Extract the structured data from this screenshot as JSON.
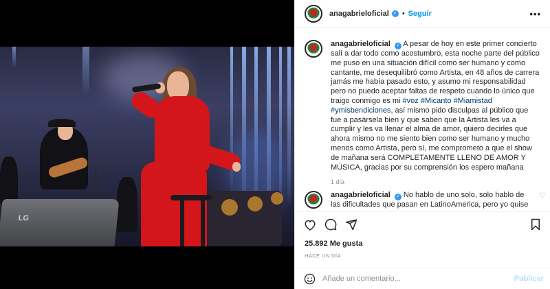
{
  "post": {
    "username": "anagabrieloficial",
    "follow_label": "Seguir",
    "more_icon": "more-horizontal-icon"
  },
  "caption": {
    "username": "anagabrieloficial",
    "text_1": "A pesar de hoy en este primer concierto salí a dar todo como acostumbro, esta noche parte del público me puso en una situación difícil como ser humano y como cantante, me desequilibró como Artista, en 48 años de carrera jamás me había pasado esto, y asumo mi responsabilidad pero no puedo aceptar faltas de respeto cuando lo único que traigo conmigo es mi",
    "hashtags": [
      "#voz",
      "#Micanto",
      "#Miamistad",
      "#ymisbendiciones"
    ],
    "text_2": ", así mismo pido disculpas al público que fue a pasársela bien y que saben que la Artista les va a cumplir y les va llenar el alma de amor, quiero decirles que ahora mismo no me siento bien como ser humano y mucho menos como Artista, pero sí, me comprometo a que el show de mañana será COMPLETAMENTE LLENO DE AMOR Y MÚSICA, gracias por su comprensión los espero mañana",
    "time": "1 día"
  },
  "reply": {
    "username": "anagabrieloficial",
    "text": "No hablo de uno solo, solo hablo de las dificultades que pasan en LatinoAmerica, pero yo quise"
  },
  "stats": {
    "likes": "25.892 Me gusta",
    "date": "Hace un día"
  },
  "composer": {
    "placeholder": "Añade un comentario...",
    "publish_label": "Publicar"
  },
  "photo": {
    "speaker_brand": "LG"
  },
  "colors": {
    "accent": "#0095f6",
    "verified": "#3897f0",
    "hashtag": "#00376b",
    "publish_disabled": "#b2dffc",
    "dress": "#d4161b"
  }
}
